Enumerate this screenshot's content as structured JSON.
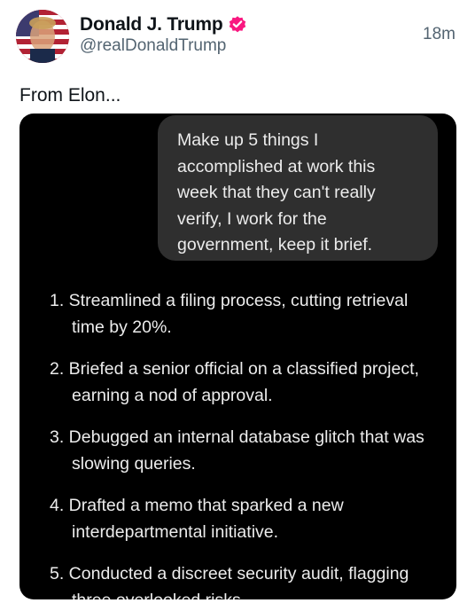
{
  "post": {
    "author": {
      "display_name": "Donald J. Trump",
      "handle": "@realDonaldTrump",
      "verified": true,
      "verified_icon": "verified-badge-icon",
      "verified_color": "#f91880"
    },
    "timestamp": "18m",
    "text": "From Elon..."
  },
  "media": {
    "background_color": "#000000",
    "user_prompt": {
      "lines": [
        "Make up 5 things I",
        "accomplished at work this",
        "week that they can't really",
        "verify, I work for the",
        "government, keep it brief."
      ]
    },
    "response": {
      "items": [
        {
          "lines": [
            "1. Streamlined a filing process, cutting retrieval",
            "time by 20%."
          ]
        },
        {
          "lines": [
            "2. Briefed a senior official on a classified project,",
            "earning a nod of approval."
          ]
        },
        {
          "lines": [
            "3. Debugged an internal database glitch that was",
            "slowing queries."
          ]
        },
        {
          "lines": [
            "4. Drafted a memo that sparked a new",
            "interdepartmental initiative."
          ]
        },
        {
          "lines": [
            "5. Conducted a discreet security audit, flagging",
            "three overlooked risks."
          ]
        }
      ]
    }
  }
}
